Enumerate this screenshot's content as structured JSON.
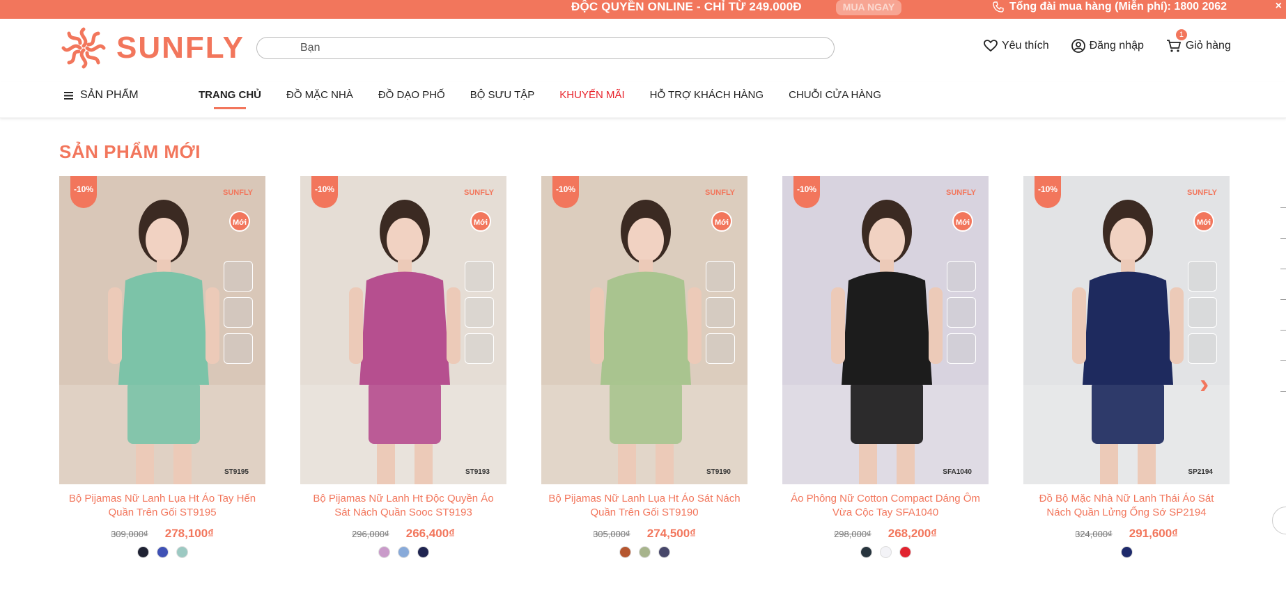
{
  "topbar": {
    "promo": "ĐỘC QUYỀN ONLINE - CHỈ TỪ 249.000Đ",
    "buy_now": "MUA NGAY",
    "hotline": "Tổng đài mua hàng (Miễn phí): 1800 2062",
    "close": "×"
  },
  "brand": {
    "name": "SUNFLY"
  },
  "search": {
    "value": "Bạn"
  },
  "header_actions": {
    "wishlist": "Yêu thích",
    "login": "Đăng nhập",
    "cart": "Giỏ hàng",
    "cart_count": "1"
  },
  "nav": {
    "all_products": "SẢN PHẨM",
    "items": [
      "TRANG CHỦ",
      "ĐỒ MẶC NHÀ",
      "ĐỒ DẠO PHỐ",
      "BỘ SƯU TẬP",
      "KHUYẾN MÃI",
      "HỖ TRỢ KHÁCH HÀNG",
      "CHUỖI CỬA HÀNG"
    ]
  },
  "section": {
    "title": "SẢN PHẨM MỚI"
  },
  "product_labels": {
    "discount": "-10%",
    "new": "Mới",
    "brand_mini": "SUNFLY"
  },
  "products": [
    {
      "name": "Bộ Pijamas Nữ Lanh Lụa Ht Áo Tay Hến Quần Trên Gối ST9195",
      "old_price": "309,000₫",
      "price": "278,100₫",
      "sku": "ST9195",
      "bg": "#d9c7b8",
      "outfit": "#7cc3a8",
      "swatches": [
        "#1f2233",
        "#3f51b5",
        "#9cc9c2"
      ]
    },
    {
      "name": "Bộ Pijamas Nữ Lanh Ht Độc Quyền Áo Sát Nách Quần Sooc ST9193",
      "old_price": "296,000₫",
      "price": "266,400₫",
      "sku": "ST9193",
      "bg": "#e5ddd5",
      "outfit": "#b64f8f",
      "swatches": [
        "#c99ac9",
        "#88aad9",
        "#1f2450"
      ]
    },
    {
      "name": "Bộ Pijamas Nữ Lanh Lụa Ht Áo Sát Nách Quần Trên Gối ST9190",
      "old_price": "305,000₫",
      "price": "274,500₫",
      "sku": "ST9190",
      "bg": "#dccdbe",
      "outfit": "#a9c48f",
      "swatches": [
        "#b5562f",
        "#a7b48c",
        "#47476a"
      ]
    },
    {
      "name": "Áo Phông Nữ Cotton Compact Dáng Ôm Vừa Cộc Tay SFA1040",
      "old_price": "298,000₫",
      "price": "268,200₫",
      "sku": "SFA1040",
      "bg": "#d8d3df",
      "outfit": "#1c1c1c",
      "swatches": [
        "#27343d",
        "#f3f3f7",
        "#e1232f"
      ]
    },
    {
      "name": "Đồ Bộ Mặc Nhà Nữ Lanh Thái Áo Sát Nách Quần Lửng Ống Sớ SP2194",
      "old_price": "324,000₫",
      "price": "291,600₫",
      "sku": "SP2194",
      "bg": "#e2e3e5",
      "outfit": "#1e2a5e",
      "swatches": [
        "#1e2a6b"
      ]
    }
  ]
}
